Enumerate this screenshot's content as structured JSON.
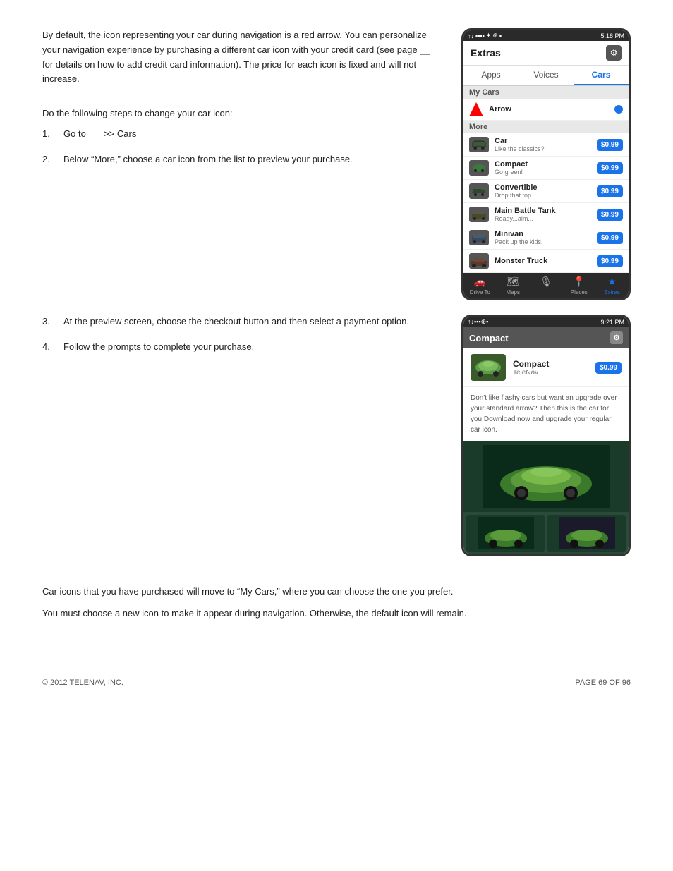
{
  "intro": {
    "text": "By default, the icon representing your car during navigation is a red arrow. You can personalize your navigation experience by purchasing a different car icon with your credit card (see page __ for details on how to add credit card information). The price for each icon is fixed and will not increase."
  },
  "step_intro": "Do the following steps to change your car icon:",
  "steps": [
    {
      "num": "1.",
      "text": "Go to",
      "highlight": ">> Cars"
    },
    {
      "num": "2.",
      "text": "Below “More,” choose a car icon from the list to preview your purchase."
    },
    {
      "num": "3.",
      "text": "At the preview screen, choose the checkout button and then select a payment option."
    },
    {
      "num": "4.",
      "text": "Follow the prompts to complete your purchase."
    }
  ],
  "phone1": {
    "status_bar": "5:18 PM",
    "header": "Extras",
    "tabs": [
      "Apps",
      "Voices",
      "Cars"
    ],
    "active_tab": "Cars",
    "my_cars_label": "My Cars",
    "arrow_label": "Arrow",
    "more_label": "More",
    "cars": [
      {
        "name": "Car",
        "desc": "Like the classics?",
        "price": "$0.99"
      },
      {
        "name": "Compact",
        "desc": "Go green!",
        "price": "$0.99"
      },
      {
        "name": "Convertible",
        "desc": "Drop that top.",
        "price": "$0.99"
      },
      {
        "name": "Main Battle Tank",
        "desc": "Ready...aim...",
        "price": "$0.99"
      },
      {
        "name": "Minivan",
        "desc": "Pack up the kids.",
        "price": "$0.99"
      },
      {
        "name": "Monster Truck",
        "desc": "",
        "price": "$0.99"
      }
    ],
    "bottom_nav": [
      "Drive To",
      "Maps",
      "",
      "Places",
      "Extras"
    ]
  },
  "phone2": {
    "status_bar": "9:21 PM",
    "header": "Compact",
    "car_name": "Compact",
    "car_brand": "TeleNav",
    "price": "$0.99",
    "description": "Don't like flashy cars but want an upgrade over your standard arrow? Then this is the car for you.Download now and upgrade your regular car icon."
  },
  "bottom_texts": [
    "Car icons that you have purchased will move to “My Cars,” where you can choose the one you prefer.",
    "You must choose a new icon to make it appear during navigation. Otherwise, the default icon will remain."
  ],
  "footer": {
    "copyright": "© 2012 TELENAV, INC.",
    "page": "PAGE 69 OF 96"
  }
}
